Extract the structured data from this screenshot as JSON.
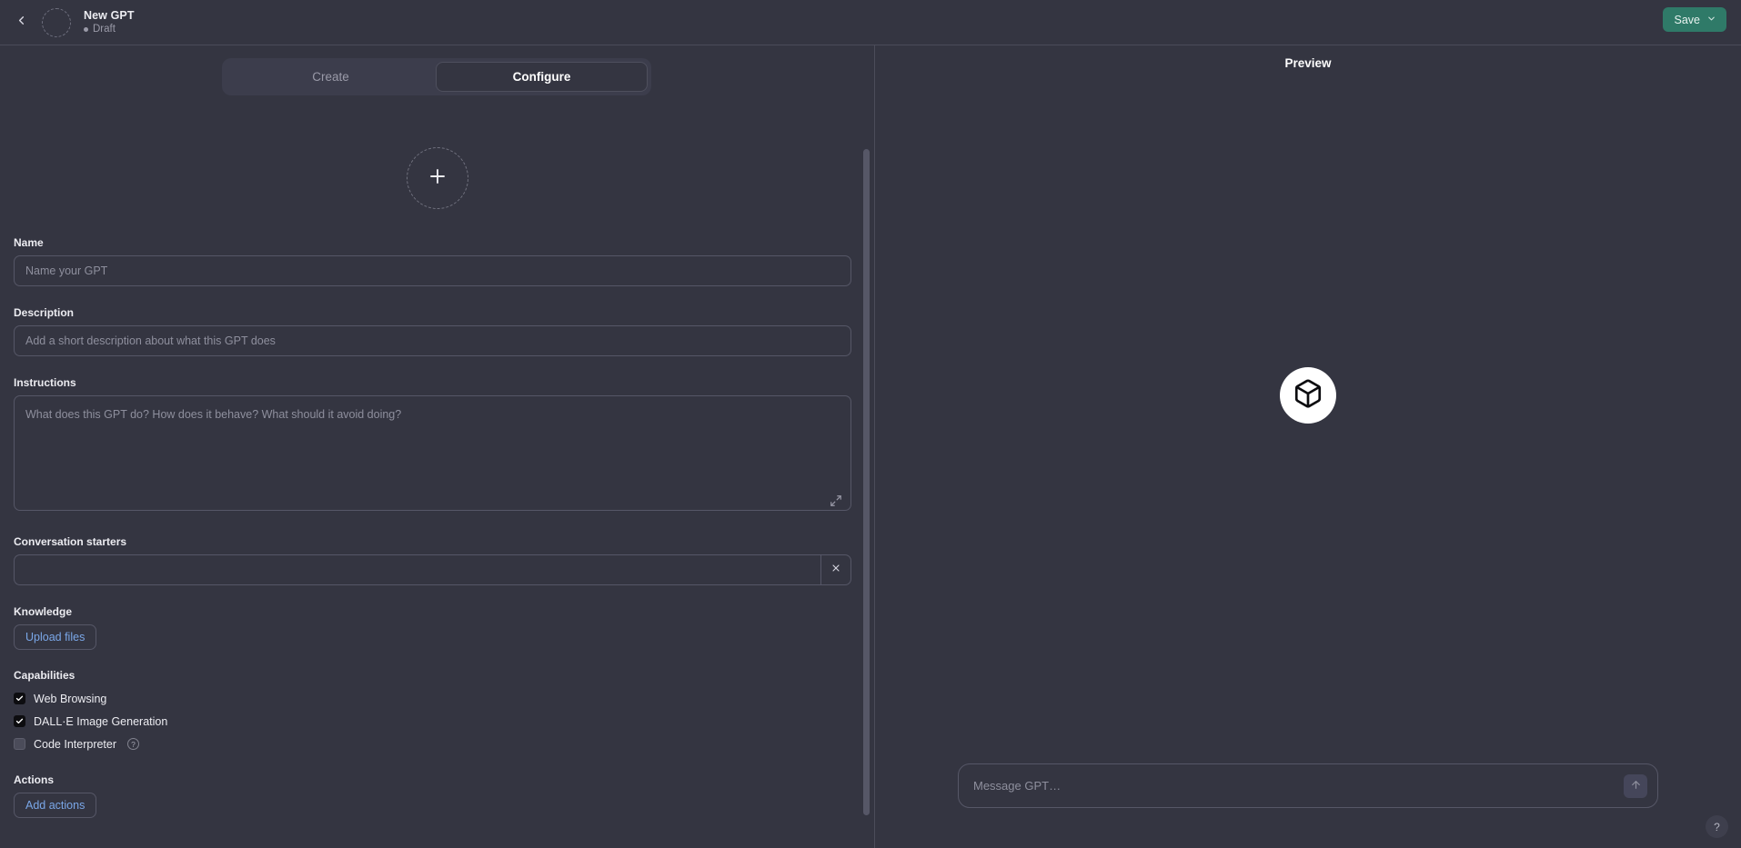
{
  "topbar": {
    "back_icon": "chevron-left-icon",
    "avatar_icon": "gpt-avatar-placeholder",
    "title": "New GPT",
    "status": "Draft",
    "save_label": "Save",
    "save_chevron_icon": "chevron-down-icon",
    "save_color": "#2f7a68"
  },
  "tabs": [
    {
      "label": "Create",
      "active": false
    },
    {
      "label": "Configure",
      "active": true
    }
  ],
  "configure": {
    "avatar_upload": {
      "icon": "plus-icon",
      "label": ""
    },
    "name": {
      "label": "Name",
      "value": "",
      "placeholder": "Name your GPT"
    },
    "description": {
      "label": "Description",
      "value": "",
      "placeholder": "Add a short description about what this GPT does"
    },
    "instructions": {
      "label": "Instructions",
      "value": "",
      "placeholder": "What does this GPT do? How does it behave? What should it avoid doing?",
      "expand_icon": "expand-diagonal-icon"
    },
    "conversation_starters": {
      "label": "Conversation starters",
      "rows": [
        {
          "value": "",
          "placeholder": "",
          "remove_icon": "close-x-icon"
        }
      ]
    },
    "knowledge": {
      "label": "Knowledge",
      "upload_label": "Upload files",
      "link_color": "#7aa7e8"
    },
    "capabilities": {
      "label": "Capabilities",
      "items": [
        {
          "label": "Web Browsing",
          "checked": true,
          "help": false
        },
        {
          "label": "DALL·E Image Generation",
          "checked": true,
          "help": false
        },
        {
          "label": "Code Interpreter",
          "checked": false,
          "help": true,
          "help_icon": "question-mark-icon"
        }
      ]
    },
    "actions": {
      "label": "Actions",
      "add_label": "Add actions"
    }
  },
  "preview": {
    "title": "Preview",
    "logo_icon": "cube-box-icon",
    "composer": {
      "value": "",
      "placeholder": "Message GPT…",
      "send_icon": "arrow-up-icon"
    }
  },
  "help_button": {
    "label": "?",
    "icon": "question-mark-icon"
  }
}
